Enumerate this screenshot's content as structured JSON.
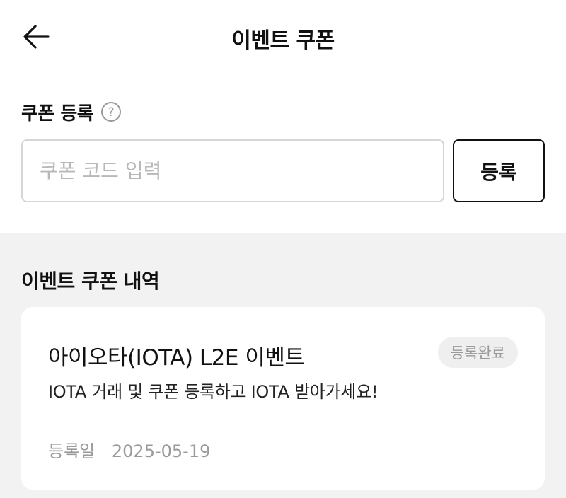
{
  "header": {
    "title": "이벤트 쿠폰",
    "back_icon": "arrow-left-icon"
  },
  "register": {
    "label": "쿠폰 등록",
    "help_icon": "question-circle-icon",
    "input_placeholder": "쿠폰 코드 입력",
    "input_value": "",
    "button_label": "등록"
  },
  "history": {
    "title": "이벤트 쿠폰 내역",
    "items": [
      {
        "title": "아이오타(IOTA) L2E 이벤트",
        "status": "등록완료",
        "description": "IOTA 거래 및 쿠폰 등록하고 IOTA 받아가세요!",
        "date_label": "등록일",
        "date": "2025-05-19"
      }
    ]
  },
  "colors": {
    "background": "#ffffff",
    "section_background": "#f2f2f2",
    "text": "#111111",
    "muted": "#9a9a9a",
    "border": "#d6d6d6"
  }
}
